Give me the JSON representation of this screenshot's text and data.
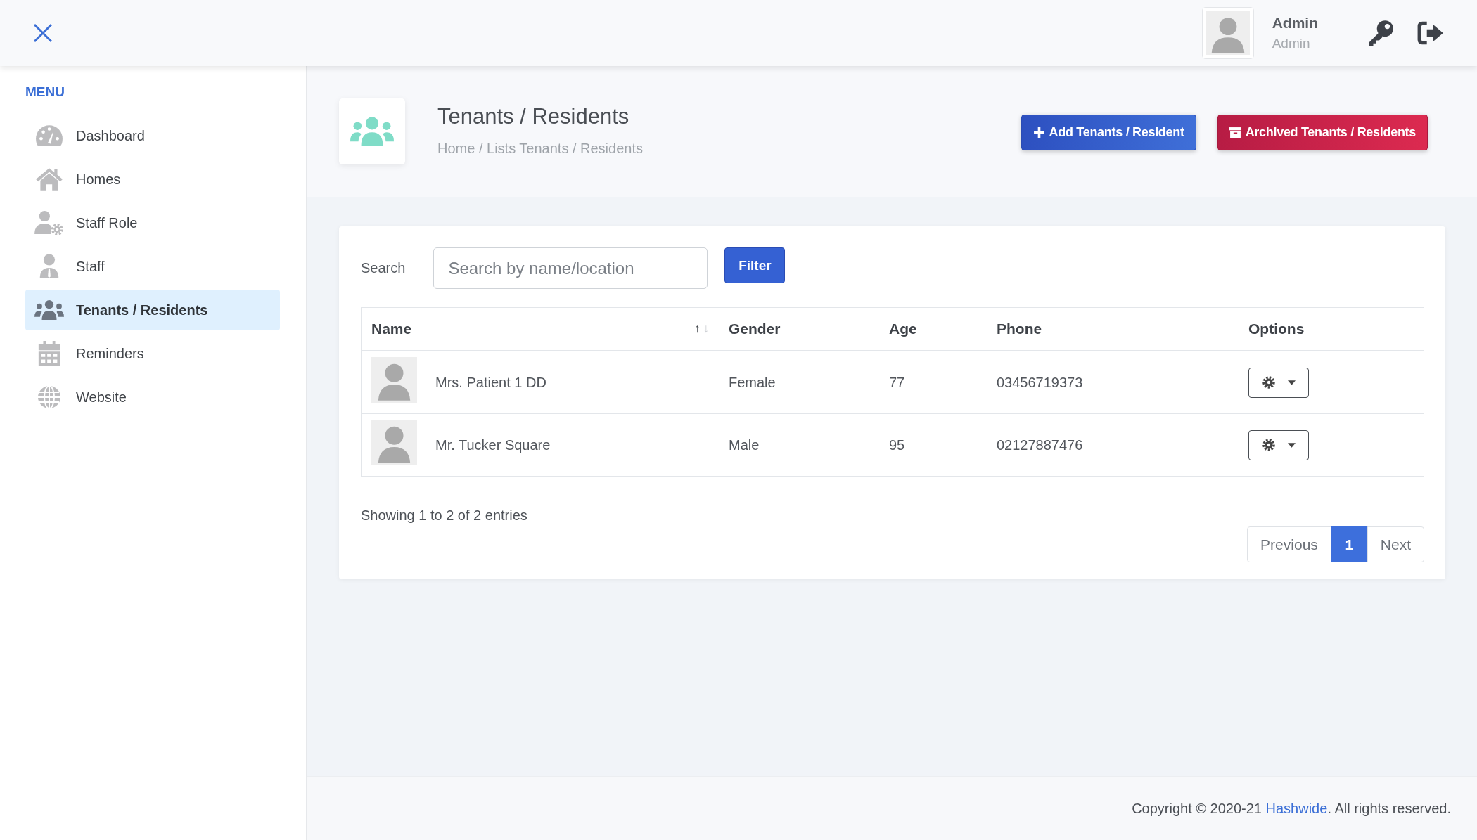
{
  "user": {
    "name": "Admin",
    "role": "Admin"
  },
  "sidebar": {
    "heading": "MENU",
    "items": [
      {
        "label": "Dashboard",
        "selected": false
      },
      {
        "label": "Homes",
        "selected": false
      },
      {
        "label": "Staff Role",
        "selected": false
      },
      {
        "label": "Staff",
        "selected": false
      },
      {
        "label": "Tenants / Residents",
        "selected": true
      },
      {
        "label": "Reminders",
        "selected": false
      },
      {
        "label": "Website",
        "selected": false
      }
    ]
  },
  "page_header": {
    "title": "Tenants / Residents",
    "breadcrumb": "Home / Lists Tenants / Residents",
    "buttons": [
      {
        "label": "Add Tenants / Resident",
        "kind": "add"
      },
      {
        "label": "Archived Tenants / Residents",
        "kind": "archive"
      }
    ]
  },
  "search": {
    "label": "Search",
    "placeholder": "Search by name/location",
    "button": "Filter"
  },
  "table": {
    "columns": [
      "Name",
      "Gender",
      "Age",
      "Phone",
      "Options"
    ],
    "sort_up": "↑",
    "sort_down": "↓",
    "rows": [
      {
        "name": "Mrs. Patient 1 DD",
        "gender": "Female",
        "age": "77",
        "phone": "03456719373"
      },
      {
        "name": "Mr. Tucker Square",
        "gender": "Male",
        "age": "95",
        "phone": "02127887476"
      }
    ]
  },
  "entries_info": "Showing 1 to 2 of 2 entries",
  "pagination": {
    "previous": "Previous",
    "next": "Next",
    "pages": [
      {
        "label": "1",
        "selected": true
      }
    ]
  },
  "footer": {
    "prefix": "Copyright © 2020-21",
    "link": "Hashwide",
    "suffix": ". All rights reserved."
  }
}
